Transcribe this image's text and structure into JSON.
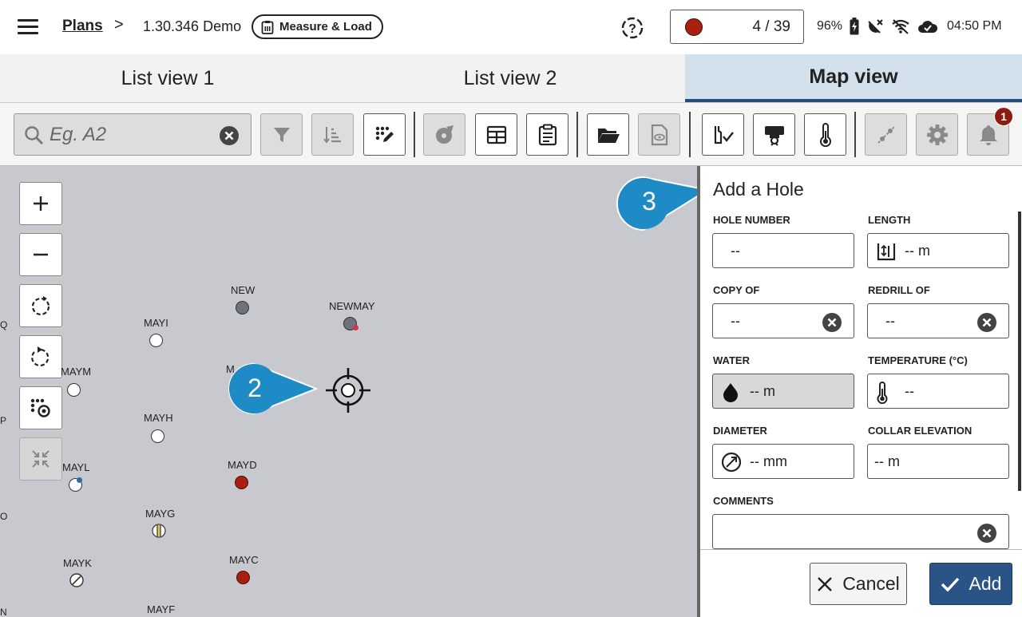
{
  "header": {
    "menu_icon": "hamburger-menu-icon",
    "breadcrumb_root": "Plans",
    "breadcrumb_separator": ">",
    "breadcrumb_item": "1.30.346 Demo",
    "mode_label": "Measure & Load",
    "mode_icon": "clipboard-load-icon",
    "help_icon": "help-question-icon",
    "counter": "4 / 39",
    "counter_dot_color": "#a8210f",
    "battery": "96%",
    "time": "04:50 PM",
    "status_icons": [
      "battery-charging-icon",
      "gps-off-icon",
      "wifi-off-icon",
      "cloud-sync-icon"
    ]
  },
  "tabs": [
    {
      "label": "List view 1",
      "active": false
    },
    {
      "label": "List view 2",
      "active": false
    },
    {
      "label": "Map view",
      "active": true
    }
  ],
  "toolbar": {
    "search_placeholder": "Eg. A2",
    "notification_count": "1",
    "buttons": [
      "filter-icon",
      "sort-icon",
      "edit-pattern-icon",
      "compass-icon",
      "table-icon",
      "clipboard-icon",
      "folder-open-icon",
      "document-view-icon",
      "charge-check-icon",
      "truck-icon",
      "thermometer-icon",
      "pin-line-icon",
      "settings-icon",
      "bell-icon"
    ]
  },
  "map": {
    "controls": [
      "zoom-in-icon",
      "zoom-out-icon",
      "rotate-icon",
      "rotate-reset-icon",
      "pattern-target-icon",
      "collapse-icon"
    ],
    "edge_labels": [
      "Q",
      "P",
      "O",
      "N"
    ],
    "holes": [
      {
        "name": "NEW",
        "state": "grey"
      },
      {
        "name": "NEWMAY",
        "state": "grey"
      },
      {
        "name": "MAYI",
        "state": "white"
      },
      {
        "name": "M",
        "state": "label"
      },
      {
        "name": "MAYM",
        "state": "white"
      },
      {
        "name": "MAYH",
        "state": "white"
      },
      {
        "name": "MAYD",
        "state": "red"
      },
      {
        "name": "MAYL",
        "state": "white"
      },
      {
        "name": "MAYG",
        "state": "striped"
      },
      {
        "name": "MAYK",
        "state": "blocked"
      },
      {
        "name": "MAYC",
        "state": "red"
      },
      {
        "name": "MAYF",
        "state": "label"
      }
    ],
    "callout_2": "2",
    "callout_3": "3"
  },
  "panel": {
    "title": "Add a Hole",
    "fields": {
      "hole_number": {
        "label": "HOLE NUMBER",
        "value": "--"
      },
      "length": {
        "label": "LENGTH",
        "value": "-- m"
      },
      "copy_of": {
        "label": "COPY OF",
        "value": "--"
      },
      "redrill_of": {
        "label": "REDRILL OF",
        "value": "--"
      },
      "water": {
        "label": "WATER",
        "value": "-- m"
      },
      "temperature": {
        "label": "TEMPERATURE (°C)",
        "value": "--"
      },
      "diameter": {
        "label": "DIAMETER",
        "value": "-- mm"
      },
      "collar_elevation": {
        "label": "COLLAR ELEVATION",
        "value": "-- m"
      },
      "comments": {
        "label": "COMMENTS",
        "value": ""
      }
    },
    "cancel_label": "Cancel",
    "add_label": "Add",
    "accent_color": "#2a5386"
  }
}
